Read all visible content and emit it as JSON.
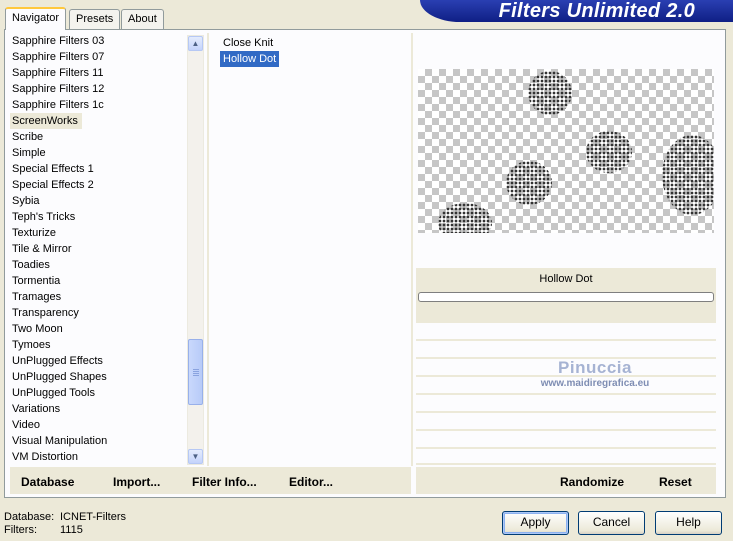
{
  "tabs": [
    "Navigator",
    "Presets",
    "About"
  ],
  "banner_title": "Filters Unlimited 2.0",
  "categories": [
    "Sapphire Filters 03",
    "Sapphire Filters 07",
    "Sapphire Filters 11",
    "Sapphire Filters 12",
    "Sapphire Filters 1c",
    "ScreenWorks",
    "Scribe",
    "Simple",
    "Special Effects 1",
    "Special Effects 2",
    "Sybia",
    "Teph's Tricks",
    "Texturize",
    "Tile & Mirror",
    "Toadies",
    "Tormentia",
    "Tramages",
    "Transparency",
    "Two Moon",
    "Tymoes",
    "UnPlugged Effects",
    "UnPlugged Shapes",
    "UnPlugged Tools",
    "Variations",
    "Video",
    "Visual Manipulation",
    "VM Distortion"
  ],
  "selected_category": "ScreenWorks",
  "filters": [
    "Close Knit",
    "Hollow Dot"
  ],
  "selected_filter": "Hollow Dot",
  "scroll_position": 0.87,
  "preview": {
    "filter_name": "Hollow Dot"
  },
  "watermark": {
    "name": "Pinuccia",
    "url": "www.maidiregrafica.eu"
  },
  "toolbar": {
    "database": "Database",
    "import": "Import...",
    "filter_info": "Filter Info...",
    "editor": "Editor...",
    "randomize": "Randomize",
    "reset": "Reset"
  },
  "status": {
    "database_label": "Database:",
    "database_value": "ICNET-Filters",
    "filters_label": "Filters:",
    "filters_value": "1115"
  },
  "buttons": {
    "apply": "Apply",
    "cancel": "Cancel",
    "help": "Help"
  }
}
